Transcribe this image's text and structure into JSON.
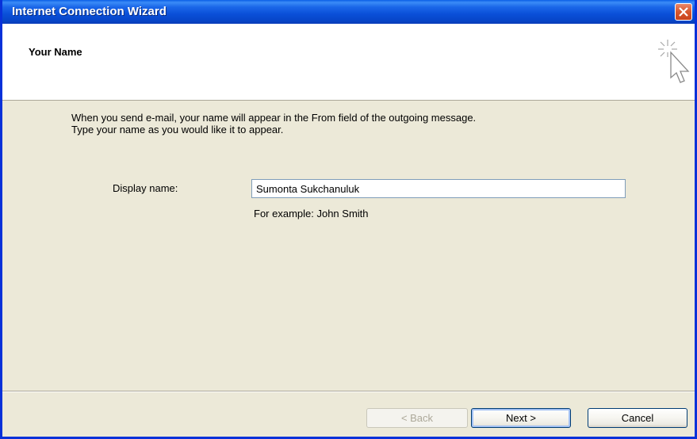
{
  "window": {
    "title": "Internet Connection Wizard",
    "close_icon": "close-icon"
  },
  "header": {
    "title": "Your Name",
    "icon": "wizard-cursor-icon"
  },
  "content": {
    "description_line1": "When you send e-mail, your name will appear in the From field of the outgoing message.",
    "description_line2": "Type your name as you would like it to appear.",
    "display_name_label": "Display name:",
    "display_name_value": "Sumonta Sukchanuluk",
    "example_text": "For example: John Smith"
  },
  "buttons": {
    "back": "< Back",
    "back_enabled": false,
    "next": "Next >",
    "cancel": "Cancel"
  },
  "colors": {
    "titlebar": "#0a4fd8",
    "body": "#ece9d8",
    "close_button": "#d6572e"
  }
}
